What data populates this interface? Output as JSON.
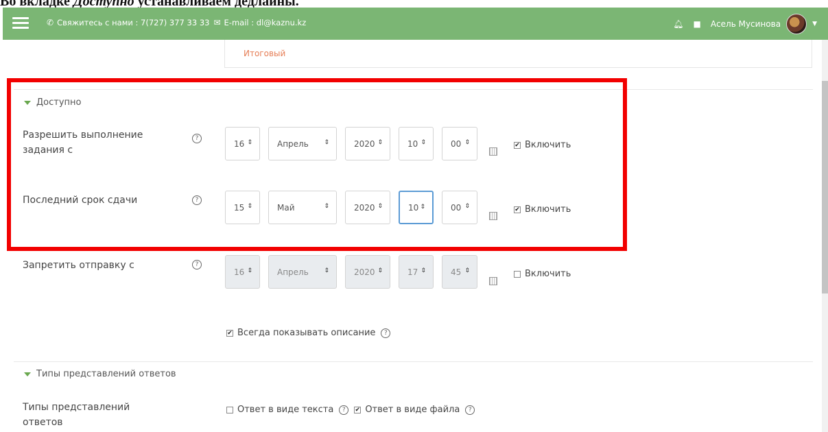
{
  "caption": {
    "prefix": "Во вкладке ",
    "italic": "Доступно",
    "suffix": " устанавливаем дедлайны."
  },
  "navbar": {
    "contact_phone": "Свяжитесь с нами : 7(727) 377 33 33",
    "contact_email": "E-mail : dl@kaznu.kz",
    "user_name": "Асель Мусинова"
  },
  "prev": {
    "item": "Итоговый"
  },
  "section_available": {
    "title": "Доступно"
  },
  "rows": [
    {
      "label": "Разрешить выполнение задания с",
      "day": "16",
      "month": "Апрель",
      "year": "2020",
      "hour": "10",
      "minute": "00",
      "enable": "Включить",
      "checked": true
    },
    {
      "label": "Последний срок сдачи",
      "day": "15",
      "month": "Май",
      "year": "2020",
      "hour": "10",
      "minute": "00",
      "enable": "Включить",
      "checked": true
    },
    {
      "label": "Запретить отправку с",
      "day": "16",
      "month": "Апрель",
      "year": "2020",
      "hour": "17",
      "minute": "45",
      "enable": "Включить",
      "checked": false
    }
  ],
  "always_show": "Всегда показывать описание",
  "section_types": {
    "title": "Типы представлений ответов",
    "row_label": "Типы представлений ответов",
    "opt_text": "Ответ в виде текста",
    "opt_file": "Ответ в виде файла"
  },
  "colors": {
    "navbar": "#7bb674",
    "highlight": "#f20000",
    "accent_link": "#e67e56"
  },
  "icons": [
    "menu-icon",
    "phone-icon",
    "mail-icon",
    "bell-icon",
    "chat-icon",
    "calendar-icon",
    "help-icon"
  ]
}
